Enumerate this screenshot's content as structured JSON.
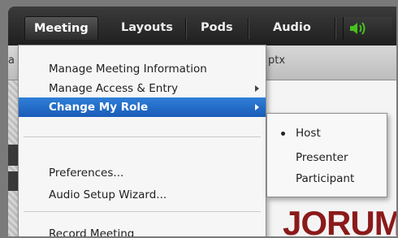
{
  "menubar": {
    "items": [
      {
        "label": "Meeting",
        "active": true
      },
      {
        "label": "Layouts",
        "active": false
      },
      {
        "label": "Pods",
        "active": false
      },
      {
        "label": "Audio",
        "active": false
      }
    ],
    "audio_icon": "speaker-volume-icon",
    "audio_icon_color": "#46c21e"
  },
  "pod": {
    "title": "ptx"
  },
  "dropdown": {
    "items": [
      {
        "label": "Manage Meeting Information",
        "has_submenu": false
      },
      {
        "label": "Manage Access & Entry",
        "has_submenu": true
      },
      {
        "label": "Change My Role",
        "has_submenu": true,
        "highlighted": true
      },
      {
        "label": "Preferences...",
        "has_submenu": false
      },
      {
        "label": "Audio Setup Wizard...",
        "has_submenu": false
      },
      {
        "label": "Record Meeting",
        "has_submenu": false
      }
    ],
    "highlight_color": "#1f66c4"
  },
  "submenu": {
    "items": [
      {
        "label": "Host",
        "selected": true
      },
      {
        "label": "Presenter",
        "selected": false
      },
      {
        "label": "Participant",
        "selected": false
      }
    ]
  },
  "background_logo": {
    "text": "JORUM",
    "partial_letter": "e",
    "color": "#8b1a1a"
  }
}
